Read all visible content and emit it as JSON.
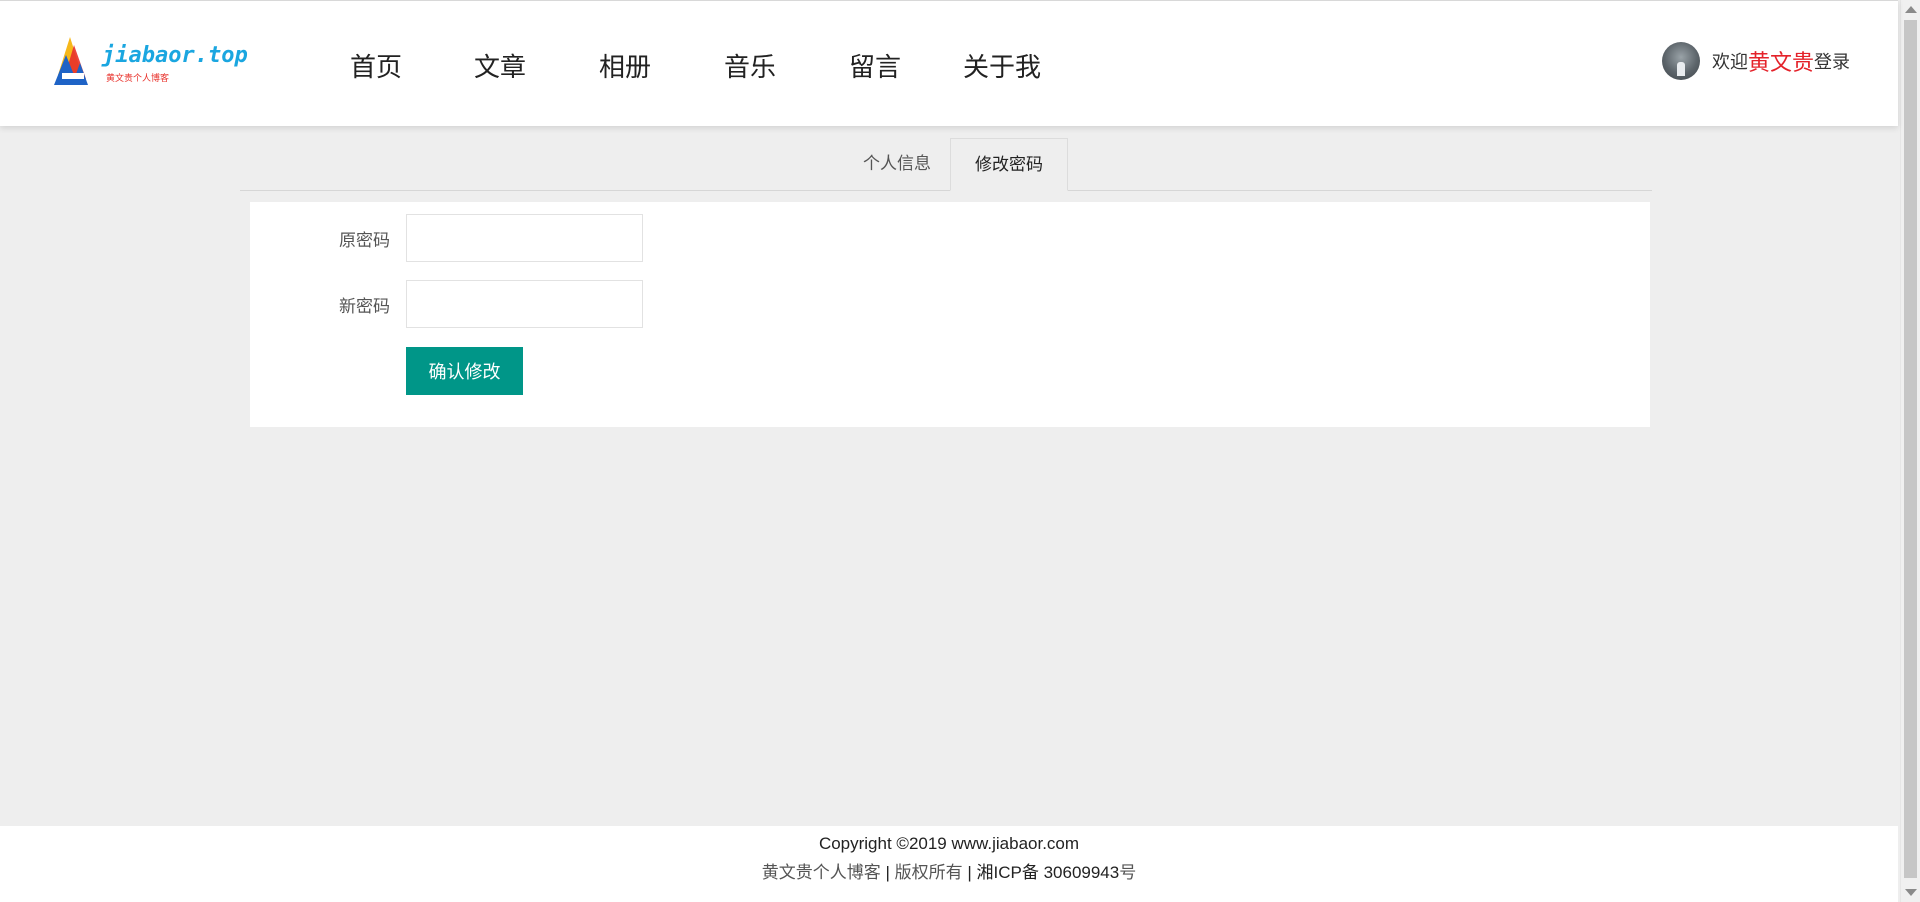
{
  "header": {
    "logo_text": "jiabaor.top",
    "logo_sub": "黄文贵个人博客",
    "nav": [
      {
        "label": "首页"
      },
      {
        "label": "文章"
      },
      {
        "label": "相册"
      },
      {
        "label": "音乐"
      },
      {
        "label": "留言"
      },
      {
        "label": "关于我"
      }
    ],
    "user": {
      "welcome": "欢迎",
      "name": "黄文贵",
      "login": "登录"
    }
  },
  "tabs": [
    {
      "label": "个人信息",
      "active": false
    },
    {
      "label": "修改密码",
      "active": true
    }
  ],
  "form": {
    "old_password_label": "原密码",
    "old_password_value": "",
    "new_password_label": "新密码",
    "new_password_value": "",
    "submit_label": "确认修改"
  },
  "footer": {
    "line1": "Copyright ©2019  www.jiabaor.com",
    "blog_name": "黄文贵个人博客",
    "sep1": " | ",
    "rights": "版权所有",
    "sep2": " | ",
    "icp": "湘ICP备 30609943",
    "icp_suffix": "号"
  },
  "colors": {
    "accent_button": "#009688",
    "username": "#e4222a",
    "logo_text": "#1aa6e0",
    "page_bg": "#eeeeee"
  },
  "icons": {
    "logo": "jiabaor-logo-icon",
    "avatar": "user-avatar",
    "scroll_up": "scroll-up-arrow-icon",
    "scroll_down": "scroll-down-arrow-icon"
  }
}
